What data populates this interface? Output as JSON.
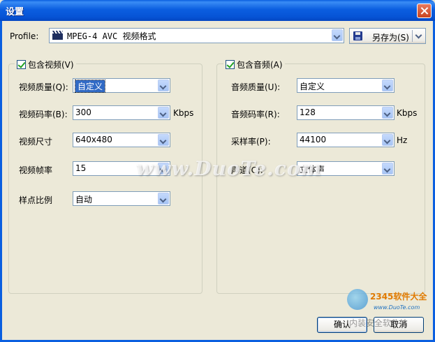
{
  "window": {
    "title": "设置"
  },
  "profile": {
    "label": "Profile:",
    "value": "MPEG-4 AVC 视频格式",
    "save_as_label": "另存为(S)"
  },
  "video": {
    "group_label": "包含视频(V)",
    "enabled": true,
    "quality_label": "视频质量(Q):",
    "quality_value": "自定义",
    "bitrate_label": "视频码率(B):",
    "bitrate_value": "300",
    "bitrate_unit": "Kbps",
    "size_label": "视频尺寸",
    "size_value": "640x480",
    "framerate_label": "视频帧率",
    "framerate_value": "15",
    "aspect_label": "样点比例",
    "aspect_value": "自动"
  },
  "audio": {
    "group_label": "包含音频(A)",
    "enabled": true,
    "quality_label": "音频质量(U):",
    "quality_value": "自定义",
    "bitrate_label": "音频码率(R):",
    "bitrate_value": "128",
    "bitrate_unit": "Kbps",
    "samplerate_label": "采样率(P):",
    "samplerate_value": "44100",
    "samplerate_unit": "Hz",
    "channel_label": "声道(C):",
    "channel_value": "立体声"
  },
  "buttons": {
    "ok_label": "确认",
    "cancel_label": "取消"
  },
  "watermarks": {
    "duote": "www.DuoTe.com",
    "brand": "2345软件大全",
    "url": "www.DuoTe.com",
    "footer": "内装安全软件站"
  }
}
